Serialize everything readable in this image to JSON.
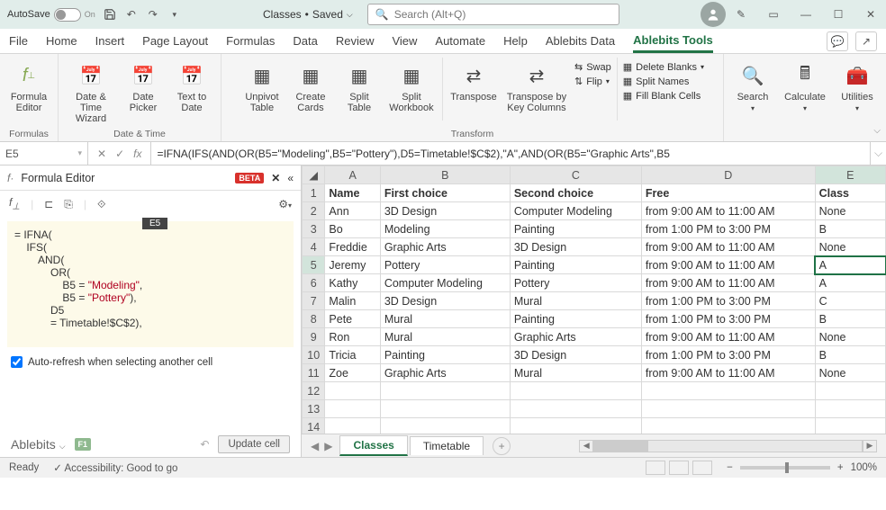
{
  "titlebar": {
    "autosave": "AutoSave",
    "autosave_state": "On",
    "docname": "Classes",
    "docstatus": "Saved",
    "search_placeholder": "Search (Alt+Q)"
  },
  "menu": {
    "tabs": [
      "File",
      "Home",
      "Insert",
      "Page Layout",
      "Formulas",
      "Data",
      "Review",
      "View",
      "Automate",
      "Help",
      "Ablebits Data",
      "Ablebits Tools"
    ]
  },
  "ribbon": {
    "formulas": {
      "label": "Formulas",
      "btn1": "Formula\nEditor"
    },
    "datetime": {
      "label": "Date & Time",
      "btn1": "Date &\nTime Wizard",
      "btn2": "Date\nPicker",
      "btn3": "Text to\nDate"
    },
    "transform": {
      "label": "Transform",
      "btn1": "Unpivot\nTable",
      "btn2": "Create\nCards",
      "btn3": "Split\nTable",
      "btn4": "Split\nWorkbook",
      "btn5": "Transpose",
      "btn6": "Transpose by\nKey Columns",
      "swap": "Swap",
      "flip": "Flip",
      "delblanks": "Delete Blanks",
      "splitnames": "Split Names",
      "fillblank": "Fill Blank Cells"
    },
    "right": {
      "search": "Search",
      "calculate": "Calculate",
      "utilities": "Utilities"
    }
  },
  "fxbar": {
    "cell": "E5",
    "formula": "=IFNA(IFS(AND(OR(B5=\"Modeling\",B5=\"Pottery\"),D5=Timetable!$C$2),\"A\",AND(OR(B5=\"Graphic Arts\",B5"
  },
  "fe": {
    "title": "Formula Editor",
    "beta": "BETA",
    "celltag": "E5",
    "lines": {
      "l1": "= IFNA(",
      "l2": "    IFS(",
      "l3": "        AND(",
      "l4": "            OR(",
      "l5a": "                B5 = ",
      "l5b": "\"Modeling\"",
      "l5c": ",",
      "l6a": "                B5 = ",
      "l6b": "\"Pottery\"",
      "l6c": "),",
      "l7": "            D5",
      "l8": "            = Timetable!$C$2),"
    },
    "autorefresh": "Auto-refresh when selecting another cell",
    "brand": "Ablebits",
    "f1": "F1",
    "update": "Update cell"
  },
  "grid": {
    "cols": [
      "A",
      "B",
      "C",
      "D",
      "E"
    ],
    "headers": [
      "Name",
      "First choice",
      "Second choice",
      "Free",
      "Class"
    ],
    "rows": [
      {
        "n": "2",
        "c": [
          "Ann",
          "3D Design",
          "Computer Modeling",
          "from 9:00 AM to 11:00 AM",
          "None"
        ]
      },
      {
        "n": "3",
        "c": [
          "Bo",
          "Modeling",
          "Painting",
          "from 1:00 PM to 3:00 PM",
          "B"
        ]
      },
      {
        "n": "4",
        "c": [
          "Freddie",
          "Graphic Arts",
          "3D Design",
          "from 9:00 AM to 11:00 AM",
          "None"
        ]
      },
      {
        "n": "5",
        "c": [
          "Jeremy",
          "Pottery",
          "Painting",
          "from 9:00 AM to 11:00 AM",
          "A"
        ]
      },
      {
        "n": "6",
        "c": [
          "Kathy",
          "Computer Modeling",
          "Pottery",
          "from 9:00 AM to 11:00 AM",
          "A"
        ]
      },
      {
        "n": "7",
        "c": [
          "Malin",
          "3D Design",
          "Mural",
          "from 1:00 PM to 3:00 PM",
          "C"
        ]
      },
      {
        "n": "8",
        "c": [
          "Pete",
          "Mural",
          "Painting",
          "from 1:00 PM to 3:00 PM",
          "B"
        ]
      },
      {
        "n": "9",
        "c": [
          "Ron",
          "Mural",
          "Graphic Arts",
          "from 9:00 AM to 11:00 AM",
          "None"
        ]
      },
      {
        "n": "10",
        "c": [
          "Tricia",
          "Painting",
          "3D Design",
          "from 1:00 PM to 3:00 PM",
          "B"
        ]
      },
      {
        "n": "11",
        "c": [
          "Zoe",
          "Graphic Arts",
          "Mural",
          "from 9:00 AM to 11:00 AM",
          "None"
        ]
      },
      {
        "n": "12",
        "c": [
          "",
          "",
          "",
          "",
          ""
        ]
      },
      {
        "n": "13",
        "c": [
          "",
          "",
          "",
          "",
          ""
        ]
      },
      {
        "n": "14",
        "c": [
          "",
          "",
          "",
          "",
          ""
        ]
      }
    ]
  },
  "sheets": {
    "tab1": "Classes",
    "tab2": "Timetable"
  },
  "status": {
    "ready": "Ready",
    "access": "Accessibility: Good to go",
    "zoom": "100%"
  }
}
